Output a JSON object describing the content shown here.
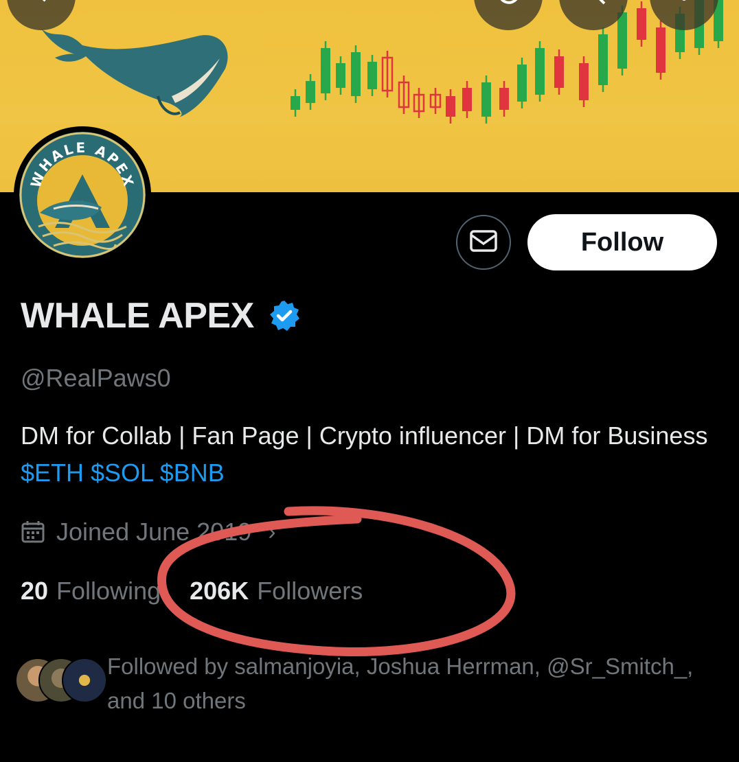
{
  "profile": {
    "avatar_text": "WHALE APEX",
    "display_name": "WHALE APEX",
    "handle": "@RealPaws0",
    "bio_text": "DM for Collab | Fan Page | Crypto influencer | DM for Business ",
    "bio_tags": "$ETH $SOL $BNB",
    "joined": "Joined June 2019",
    "following_count": "20",
    "following_label": "Following",
    "followers_count": "206K",
    "followers_label": "Followers",
    "followed_by": "Followed by salmanjoyia, Joshua Herrman, @Sr_Smitch_, and 10 others"
  },
  "actions": {
    "follow_label": "Follow"
  },
  "icons": {
    "back": "back-arrow-icon",
    "refresh": "refresh-icon",
    "search": "search-icon",
    "more": "more-vertical-icon",
    "message": "envelope-icon",
    "verified": "verified-badge-icon",
    "calendar": "calendar-icon"
  },
  "colors": {
    "banner": "#efc13e",
    "link": "#1d9bf0",
    "secondary_text": "#71767b",
    "annotation": "#e05a55"
  }
}
